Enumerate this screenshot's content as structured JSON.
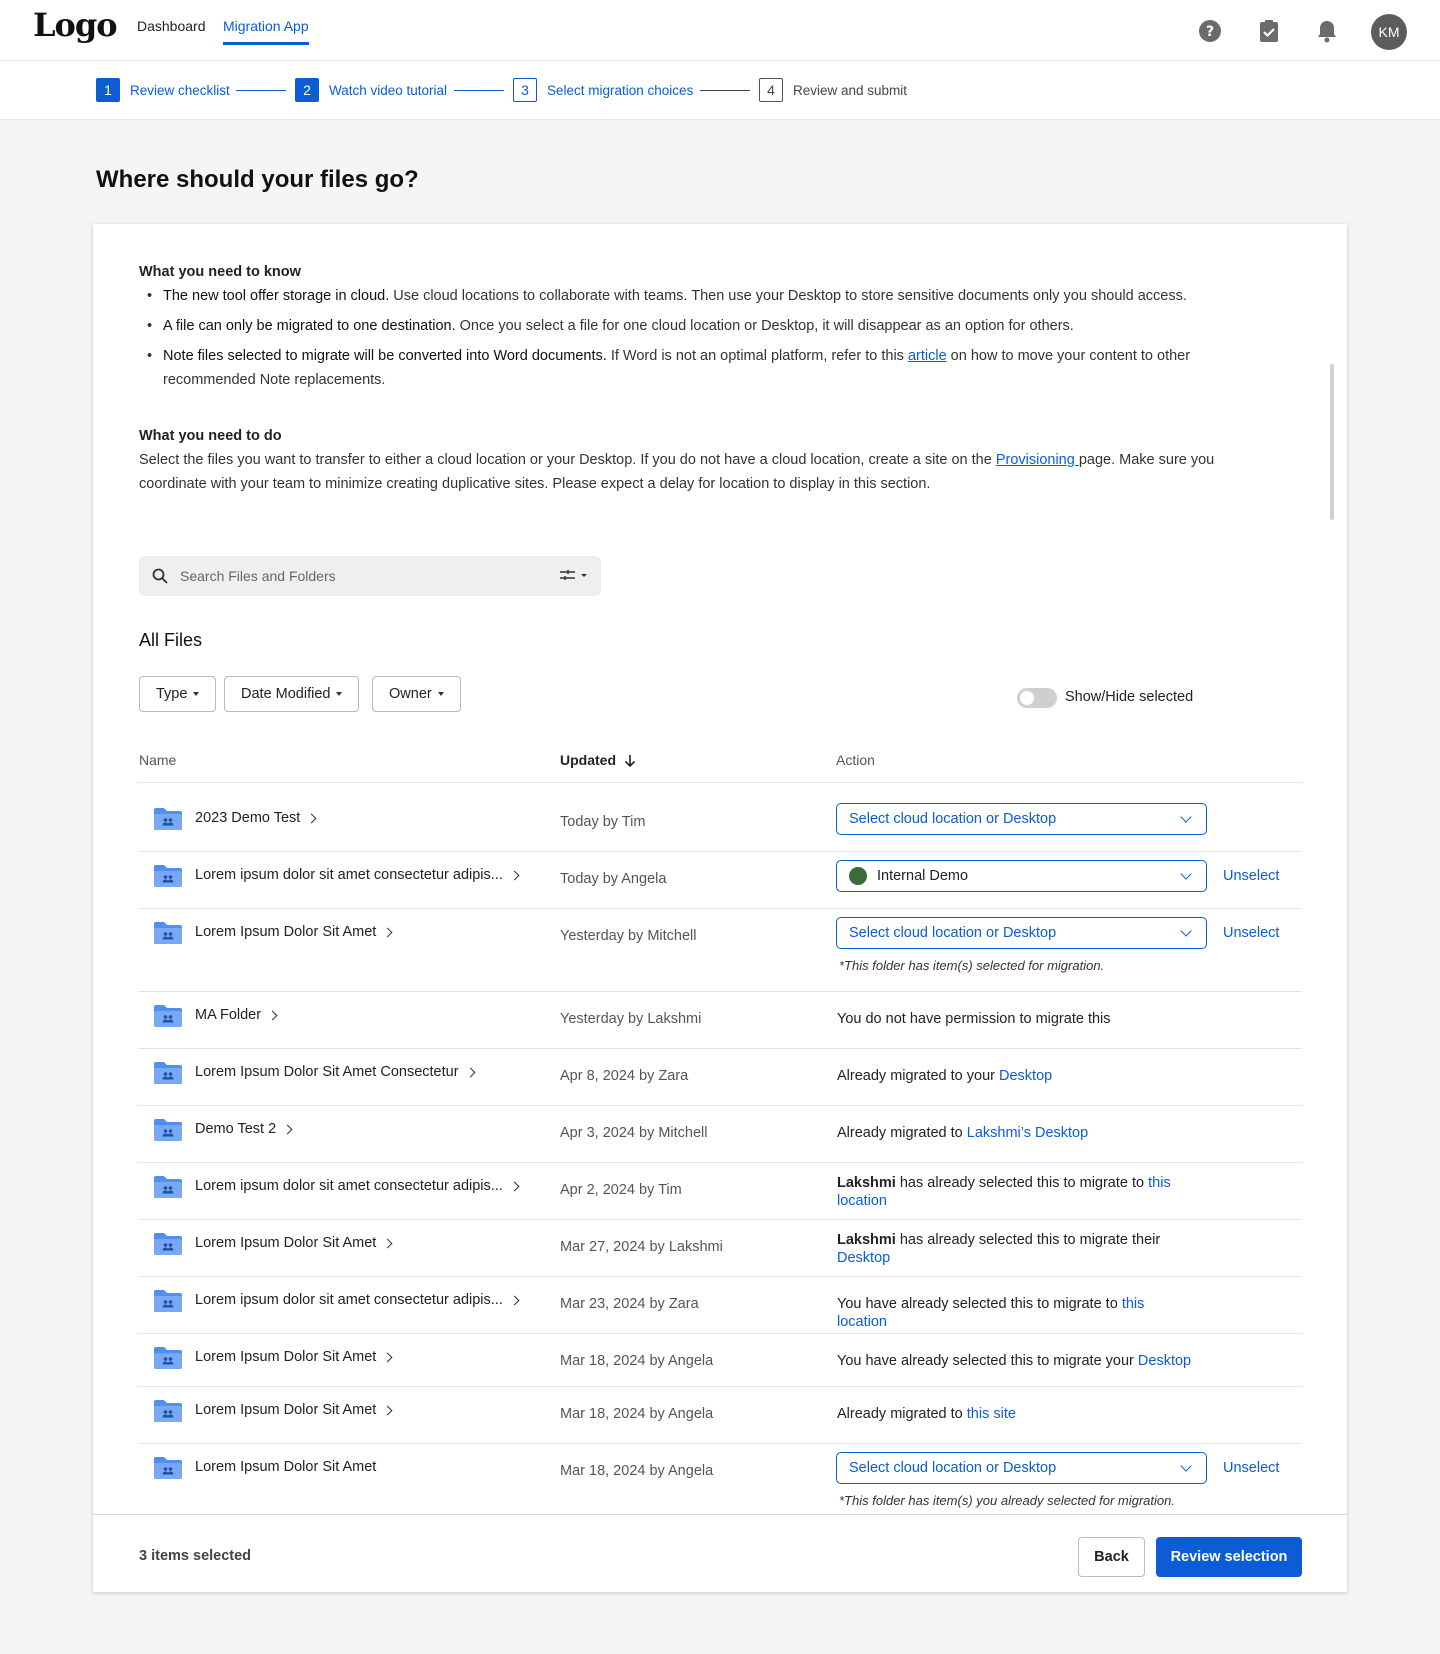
{
  "header": {
    "logo": "Logo",
    "nav": [
      "Dashboard",
      "Migration App"
    ],
    "avatar": "KM"
  },
  "steps": [
    {
      "num": "1",
      "label": "Review checklist"
    },
    {
      "num": "2",
      "label": "Watch video tutorial"
    },
    {
      "num": "3",
      "label": "Select migration choices"
    },
    {
      "num": "4",
      "label": "Review and submit"
    }
  ],
  "page_title": "Where should your files go?",
  "know": {
    "title": "What you need to know",
    "b1_bold": "The new tool offer storage in cloud.",
    "b1_rest": " Use cloud locations to collaborate with teams. Then use your Desktop to store sensitive documents only you should access.",
    "b2_bold": "A file can only be migrated to one destination.",
    "b2_rest": " Once you select a file for one cloud location or Desktop, it will disappear as an option for others.",
    "b3_bold": "Note files selected to migrate will be converted into Word documents.",
    "b3_pre": " If Word is not an optimal platform, refer to this ",
    "b3_link": "article",
    "b3_post": " on how to move your content to other recommended Note replacements."
  },
  "todo": {
    "title": "What you need to do",
    "pre": "Select the files you want to transfer to either a cloud location or your Desktop. If you do not have a cloud location, create a site on the ",
    "link": "Provisioning ",
    "post": "page. Make sure you coordinate with your team to minimize creating duplicative sites. Please expect a delay for location to display in this section."
  },
  "search": {
    "placeholder": "Search Files and Folders"
  },
  "all_files": "All Files",
  "filters": [
    "Type",
    "Date Modified",
    "Owner"
  ],
  "toggle_label": "Show/Hide selected",
  "columns": {
    "name": "Name",
    "updated": "Updated",
    "action": "Action"
  },
  "rows": [
    {
      "name": "2023 Demo Test",
      "updated": "Today by Tim",
      "select": "Select cloud location or Desktop"
    },
    {
      "name": "Lorem ipsum dolor sit amet consectetur adipis...",
      "updated": "Today by Angela",
      "select": "Internal Demo",
      "unselect": "Unselect"
    },
    {
      "name": "Lorem Ipsum Dolor Sit Amet",
      "updated": "Yesterday by Mitchell",
      "select": "Select cloud location or Desktop",
      "unselect": "Unselect",
      "note": "*This folder has item(s) selected for migration."
    },
    {
      "name": "MA Folder",
      "updated": "Yesterday by Lakshmi",
      "action": "You do not have permission to migrate this"
    },
    {
      "name": "Lorem Ipsum Dolor Sit Amet Consectetur",
      "updated": "Apr 8, 2024 by Zara",
      "action": "Already migrated to your ",
      "action_link": "Desktop"
    },
    {
      "name": "Demo Test 2",
      "updated": "Apr 3, 2024 by Mitchell",
      "action": "Already migrated to ",
      "action_link": "Lakshmi’s Desktop"
    },
    {
      "name": "Lorem ipsum dolor sit amet consectetur adipis...",
      "updated": "Apr 2, 2024 by Tim",
      "action_bold": "Lakshmi",
      "action": " has already selected this to migrate to ",
      "action_link": "this location"
    },
    {
      "name": "Lorem Ipsum Dolor Sit Amet",
      "updated": "Mar 27, 2024 by Lakshmi",
      "action_bold": "Lakshmi",
      "action": " has already selected this to migrate their ",
      "action_link": "Desktop"
    },
    {
      "name": "Lorem ipsum dolor sit amet consectetur adipis...",
      "updated": "Mar 23, 2024 by Zara",
      "action": "You have already selected this to migrate to ",
      "action_link": "this location"
    },
    {
      "name": "Lorem Ipsum Dolor Sit Amet",
      "updated": "Mar 18, 2024 by Angela",
      "action": "You have already selected this to migrate your ",
      "action_link": "Desktop"
    },
    {
      "name": "Lorem Ipsum Dolor Sit Amet",
      "updated": "Mar 18, 2024 by Angela",
      "action": "Already migrated to ",
      "action_link": "this site"
    },
    {
      "name": "Lorem Ipsum Dolor Sit Amet",
      "updated": "Mar 18, 2024 by Angela",
      "select": "Select cloud location or Desktop",
      "unselect": "Unselect",
      "note": "*This folder has item(s) you already selected for migration."
    }
  ],
  "footer": {
    "count": "3 items selected",
    "back": "Back",
    "review": "Review selection"
  },
  "colors": {
    "accent": "#0b5cd5",
    "folder": "#4f8ff2",
    "dot": "#3a6b3a"
  }
}
